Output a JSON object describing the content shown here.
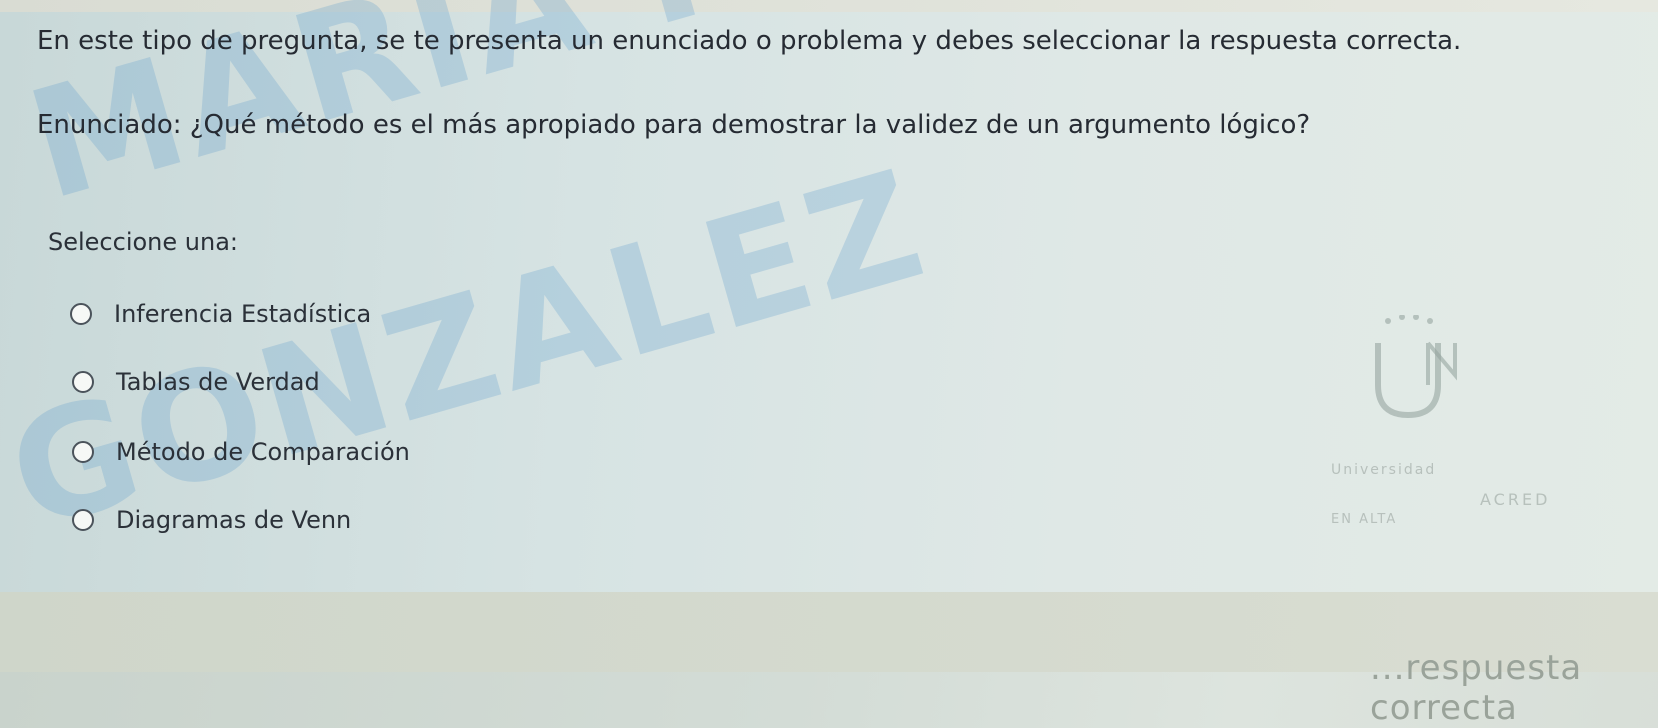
{
  "quiz": {
    "instruction": "En este tipo de pregunta, se te presenta un enunciado o problema y debes seleccionar la respuesta correcta.",
    "statement": "Enunciado: ¿Qué método es el más apropiado para demostrar la validez de un argumento lógico?",
    "select_label": "Seleccione una:",
    "options": [
      {
        "label": "Inferencia Estadística",
        "selected": false
      },
      {
        "label": "Tablas de Verdad",
        "selected": false
      },
      {
        "label": "Método de Comparación",
        "selected": false
      },
      {
        "label": "Diagramas de Venn",
        "selected": false
      }
    ]
  },
  "watermark": {
    "line1": "MARIA FERNANDA CUELTAN",
    "line2": "GONZALEZ"
  },
  "logo": {
    "word1": "Universidad",
    "word2": "ACRED",
    "word3": "EN ALTA"
  },
  "footer": {
    "partial_text": "...respuesta correcta"
  },
  "colors": {
    "watermark": "#629ecd",
    "text": "#262b33"
  }
}
